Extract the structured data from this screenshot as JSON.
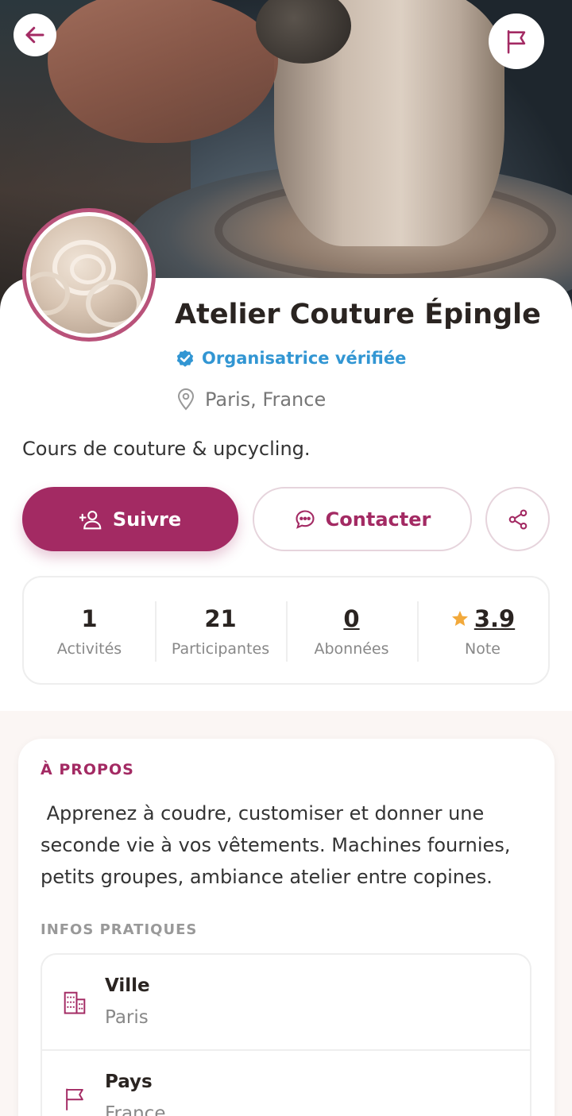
{
  "organizer": {
    "name": "Atelier Couture Épingle",
    "verified_label": "Organisatrice vérifiée",
    "location": "Paris, France",
    "tagline": "Cours de couture & upcycling."
  },
  "actions": {
    "follow_label": "Suivre",
    "contact_label": "Contacter"
  },
  "stats": {
    "activities": {
      "value": "1",
      "label": "Activités"
    },
    "participants": {
      "value": "21",
      "label": "Participantes"
    },
    "followers": {
      "value": "0",
      "label": "Abonnées"
    },
    "rating": {
      "value": "3.9",
      "label": "Note"
    }
  },
  "about": {
    "title": "À PROPOS",
    "text": " Apprenez à coudre, customiser et donner une seconde vie à vos vêtements. Machines fournies, petits groupes, ambiance atelier entre copines."
  },
  "infos": {
    "title": "INFOS PRATIQUES",
    "items": [
      {
        "label": "Ville",
        "value": "Paris",
        "icon": "building-icon"
      },
      {
        "label": "Pays",
        "value": "France",
        "icon": "flag-icon"
      }
    ]
  },
  "colors": {
    "brand": "#a32a63",
    "verified": "#3296d3",
    "star": "#f2a93b"
  }
}
